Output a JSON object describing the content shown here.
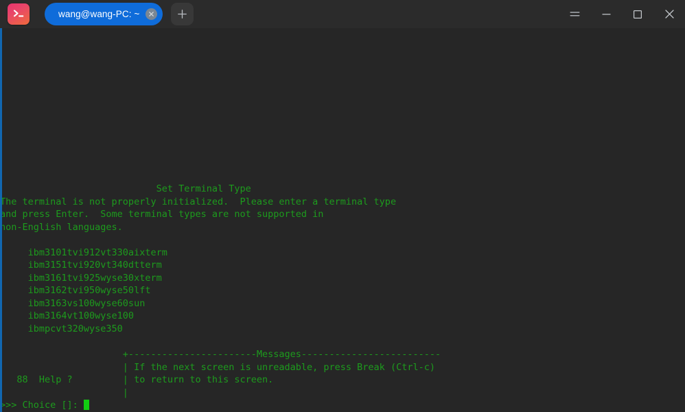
{
  "window": {
    "app_icon": "terminal-prompt-icon",
    "menu_icon": "hamburger-menu-icon",
    "minimize_icon": "minimize-icon",
    "maximize_icon": "maximize-icon",
    "close_icon": "close-icon"
  },
  "tabs": [
    {
      "title": "wang@wang-PC: ~",
      "close_icon": "tab-close-icon",
      "active": true
    }
  ],
  "newtab": {
    "label": "+",
    "icon": "plus-icon"
  },
  "terminal": {
    "background": "#262626",
    "foreground": "#1d9b1d",
    "cursor_color": "#12cc12",
    "accent": "#1167b1",
    "title": "Set Terminal Type",
    "title_indent": 28,
    "intro_lines": [
      "The terminal is not properly initialized.  Please enter a terminal type",
      "and press Enter.  Some terminal types are not supported in",
      "non-English languages."
    ],
    "columns": [
      [
        "ibm3101",
        "ibm3151",
        "ibm3161",
        "ibm3162",
        "ibm3163",
        "ibm3164",
        "ibmpc"
      ],
      [
        "tvi912",
        "tvi920",
        "tvi925",
        "tvi950",
        "vs100",
        "vt100",
        "vt320"
      ],
      [
        "vt330",
        "vt340",
        "wyse30",
        "wyse50",
        "wyse60",
        "wyse100",
        "wyse350"
      ],
      [
        "aixterm",
        "dtterm",
        "xterm",
        "lft",
        "sun"
      ]
    ],
    "column_indents": [
      5,
      23,
      39,
      55
    ],
    "messages_box": {
      "top_border": "+-----------------------Messages-------------------------",
      "lines": [
        "| If the next screen is unreadable, press Break (Ctrl-c)",
        "| to return to this screen.",
        "|"
      ],
      "indent": 22
    },
    "help_line": {
      "number": "88",
      "label": "Help ?",
      "indent": 3
    },
    "prompt": ">>> Choice []: ",
    "prompt_value": ""
  }
}
